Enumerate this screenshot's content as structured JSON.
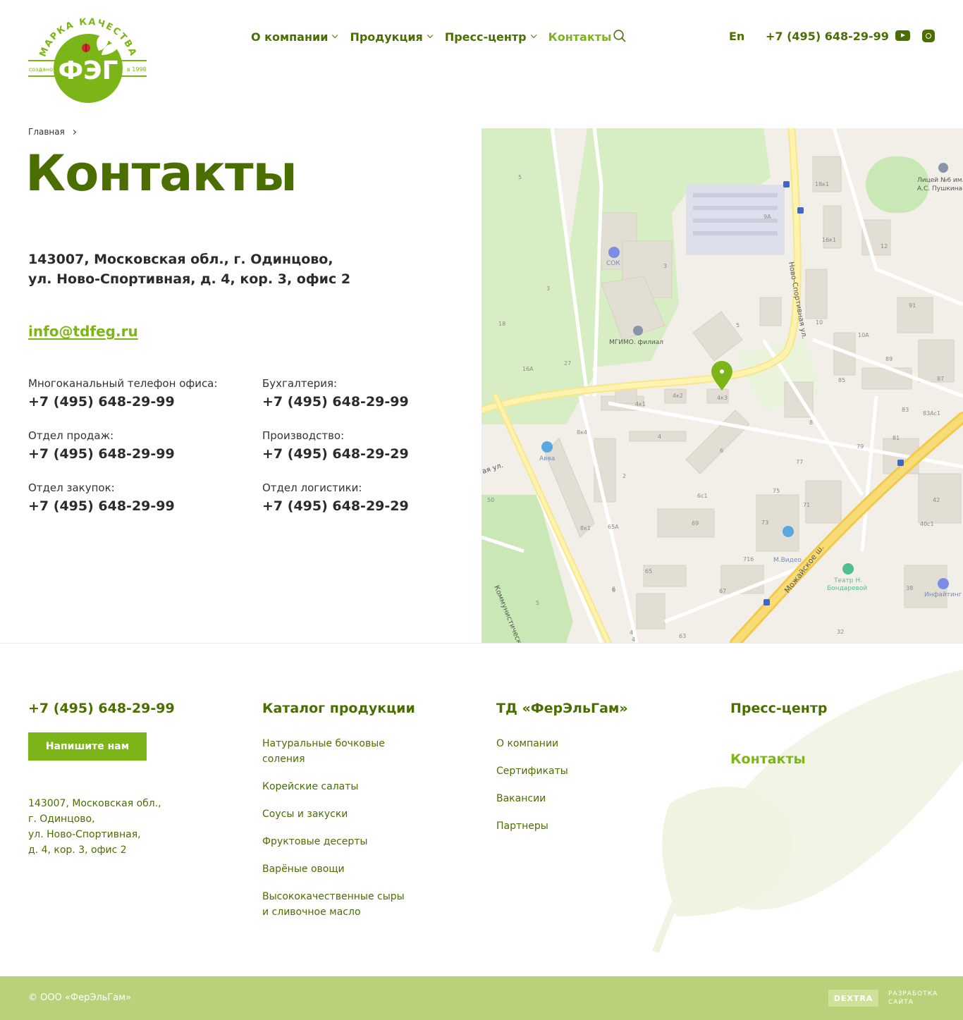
{
  "header": {
    "logo": {
      "arc_text": "МАРКА КАЧЕСТВА",
      "brand": "ФЭГ",
      "left_text": "создано",
      "right_text": "в 1998"
    },
    "nav": [
      {
        "label": "О компании",
        "has_dropdown": true
      },
      {
        "label": "Продукция",
        "has_dropdown": true
      },
      {
        "label": "Пресс-центр",
        "has_dropdown": true
      },
      {
        "label": "Контакты",
        "has_dropdown": false,
        "active": true
      }
    ],
    "lang": "En",
    "phone": "+7 (495) 648-29-99",
    "icons": [
      "search-icon",
      "youtube-icon",
      "instagram-icon"
    ]
  },
  "breadcrumb": {
    "home": "Главная"
  },
  "page": {
    "title": "Контакты",
    "address_line1": "143007, Московская обл., г. Одинцово,",
    "address_line2": "ул. Ново-Спортивная, д. 4, кор. 3, офис 2",
    "email": "info@tdfeg.ru",
    "contacts": [
      {
        "label": "Многоканальный телефон офиса:",
        "phone": "+7 (495) 648-29-99"
      },
      {
        "label": "Бухгалтерия:",
        "phone": "+7 (495) 648-29-99"
      },
      {
        "label": "Отдел продаж:",
        "phone": "+7 (495) 648-29-99"
      },
      {
        "label": "Производство:",
        "phone": "+7 (495) 648-29-29"
      },
      {
        "label": "Отдел закупок:",
        "phone": "+7 (495) 648-29-99"
      },
      {
        "label": "Отдел логистики:",
        "phone": "+7 (495) 648-29-29"
      }
    ]
  },
  "map": {
    "labels": {
      "sok": "СОК",
      "mgimo": "МГИМО. филиал",
      "street_novosport": "Ново-Спортивная ул.",
      "street_mozhaisk": "Можайское ш.",
      "street_kommun": "Коммунистическ...",
      "street_left": "ая ул.",
      "avva": "Авва",
      "mvideo": "М.Видео",
      "theatre_1": "Театр Н.",
      "theatre_2": "Бондаревой",
      "lyceum_1": "Лицей №6 им.",
      "lyceum_2": "А.С. Пушкина",
      "infight": "Инфайтинг"
    },
    "house_numbers": [
      "5",
      "3",
      "18",
      "16А",
      "27",
      "3",
      "5",
      "10",
      "10А",
      "89",
      "85",
      "87",
      "83",
      "83Ас1",
      "81",
      "79",
      "77",
      "75",
      "71",
      "73",
      "69",
      "65А",
      "65",
      "67",
      "63",
      "6",
      "4",
      "2",
      "8к1",
      "8к4",
      "4к1",
      "4к2",
      "4к3",
      "4",
      "6",
      "6с1",
      "8",
      "91",
      "12",
      "16к1",
      "18к1",
      "9А",
      "50",
      "42",
      "40с1",
      "38",
      "32",
      "716",
      "5",
      "6",
      "4"
    ],
    "pin_color": "#7cb518"
  },
  "footer": {
    "phone": "+7 (495) 648-29-99",
    "button": "Напишите нам",
    "address": [
      "143007, Московская обл.,",
      "г. Одинцово,",
      "ул. Ново-Спортивная,",
      "д. 4, кор. 3, офис 2"
    ],
    "catalog": {
      "title": "Каталог продукции",
      "items": [
        "Натуральные бочковые соления",
        "Корейские салаты",
        "Соусы и закуски",
        "Фруктовые десерты",
        "Варёные овощи",
        "Высококачественные сыры и сливочное масло"
      ]
    },
    "company": {
      "title": "ТД «ФерЭльГам»",
      "items": [
        "О компании",
        "Сертификаты",
        "Вакансии",
        "Партнеры"
      ]
    },
    "press": "Пресс-центр",
    "contacts": "Контакты"
  },
  "bottom": {
    "copyright": "© ООО «ФерЭльГам»",
    "dev_badge": "DEXTRA",
    "dev_text": "РАЗРАБОТКА САЙТА"
  },
  "colors": {
    "primary_dark": "#4a6e00",
    "primary_light": "#7cb518",
    "bottom_bar": "#b9d27a"
  }
}
